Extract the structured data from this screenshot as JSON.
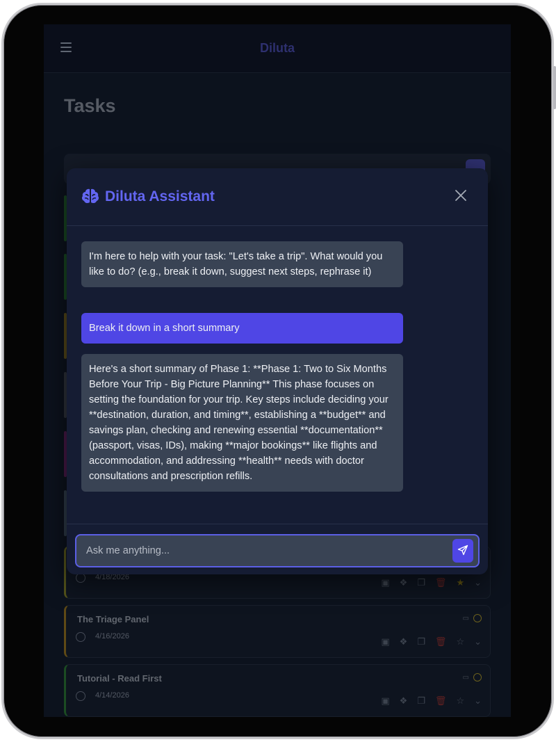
{
  "app": {
    "brand": "Diluta"
  },
  "page": {
    "title": "Tasks"
  },
  "tasks": [
    {
      "title": "",
      "date": "4/18/2026",
      "starred": true
    },
    {
      "title": "The Triage Panel",
      "date": "4/16/2026",
      "starred": false
    },
    {
      "title": "Tutorial - Read First",
      "date": "4/14/2026",
      "starred": false
    }
  ],
  "assistant": {
    "title": "Diluta Assistant",
    "messages": [
      {
        "role": "bot",
        "text": "I'm here to help with your task: \"Let's take a trip\". What would you like to do? (e.g., break it down, suggest next steps, rephrase it)"
      },
      {
        "role": "user",
        "text": "Break it down in a short summary"
      },
      {
        "role": "bot",
        "text": "Here's a short summary of Phase 1: **Phase 1: Two to Six Months Before Your Trip - Big Picture Planning** This phase focuses on setting the foundation for your trip. Key steps include deciding your **destination, duration, and timing**, establishing a **budget** and savings plan, checking and renewing essential **documentation** (passport, visas, IDs), making **major bookings** like flights and accommodation, and addressing **health** needs with doctor consultations and prescription refills."
      }
    ],
    "input_placeholder": "Ask me anything..."
  },
  "colors": {
    "accent": "#6366f1",
    "user_bubble": "#4f46e5",
    "bot_bubble": "#394354"
  }
}
